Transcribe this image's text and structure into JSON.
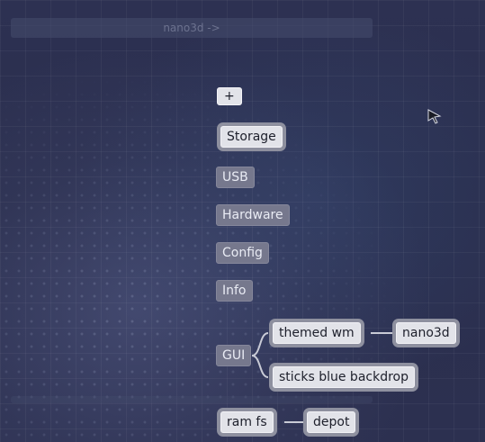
{
  "window": {
    "title": "nano3d ->"
  },
  "nodes": {
    "add": "+",
    "storage": "Storage",
    "usb": "USB",
    "hardware": "Hardware",
    "config": "Config",
    "info": "Info",
    "gui": "GUI",
    "themed_wm": "themed wm",
    "nano3d": "nano3d",
    "sticks_backdrop": "sticks blue backdrop",
    "ram_fs": "ram fs",
    "depot": "depot"
  },
  "icons": {
    "pointer": "mouse-pointer-icon"
  },
  "colors": {
    "background": "#2b2f4f",
    "node_dim": "#76788d",
    "node_bright": "#e2e3e9",
    "node_halo": "#8e909f",
    "link": "#c9cbd6"
  }
}
